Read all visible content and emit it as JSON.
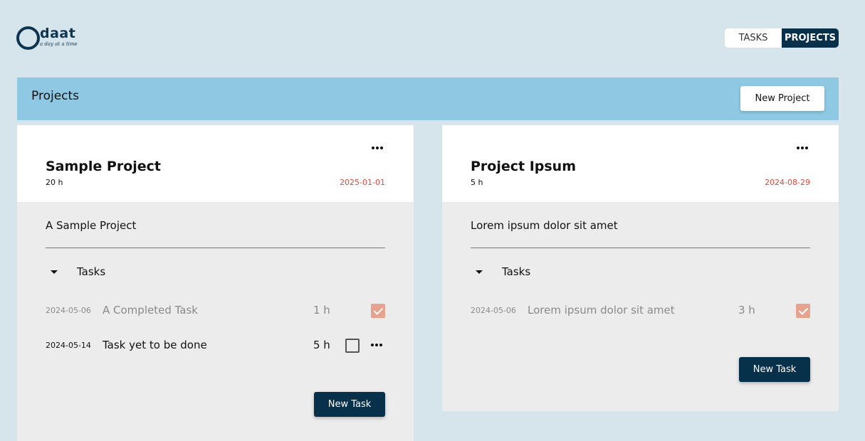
{
  "logo": {
    "word": "daat",
    "tagline": "a day at a time"
  },
  "nav": {
    "tasks": "TASKS",
    "projects": "PROJECTS"
  },
  "header": {
    "title": "Projects",
    "new_project": "New Project"
  },
  "projects": [
    {
      "name": "Sample Project",
      "hours": "20 h",
      "due": "2025-01-01",
      "description": "A Sample Project",
      "tasks_label": "Tasks",
      "tasks": [
        {
          "date": "2024-05-06",
          "name": "A Completed Task",
          "hours": "1 h",
          "done": true
        },
        {
          "date": "2024-05-14",
          "name": "Task yet to be done",
          "hours": "5 h",
          "done": false
        }
      ],
      "new_task": "New Task"
    },
    {
      "name": "Project Ipsum",
      "hours": "5 h",
      "due": "2024-08-29",
      "description": "Lorem ipsum dolor sit amet",
      "tasks_label": "Tasks",
      "tasks": [
        {
          "date": "2024-05-06",
          "name": "Lorem ipsum dolor sit amet",
          "hours": "3 h",
          "done": true
        }
      ],
      "new_task": "New Task"
    }
  ],
  "colors": {
    "accent": "#07304a",
    "header_bar": "#8fc8e3",
    "due_date": "#e04a3c",
    "checked": "#e8a38e"
  }
}
